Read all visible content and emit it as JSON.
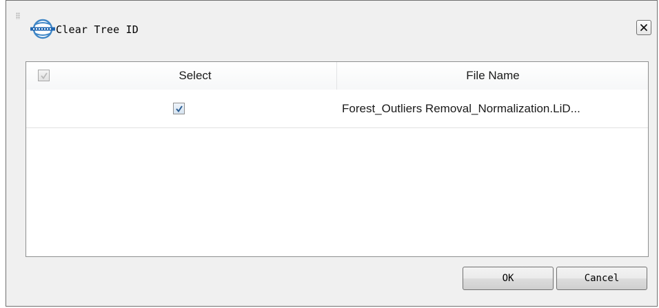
{
  "window": {
    "title": "Clear Tree ID",
    "logo_icon": "lidar-globe-logo-icon",
    "close_icon": "close-x-icon"
  },
  "table": {
    "header_checkbox_checked": true,
    "columns": [
      "Select",
      "File Name"
    ],
    "rows": [
      {
        "selected": true,
        "file_name": "Forest_Outliers Removal_Normalization.LiD..."
      }
    ]
  },
  "buttons": {
    "ok_label": "OK",
    "cancel_label": "Cancel"
  },
  "colors": {
    "dialog_bg": "#f0f0f0",
    "check_mark": "#2b5d93"
  }
}
